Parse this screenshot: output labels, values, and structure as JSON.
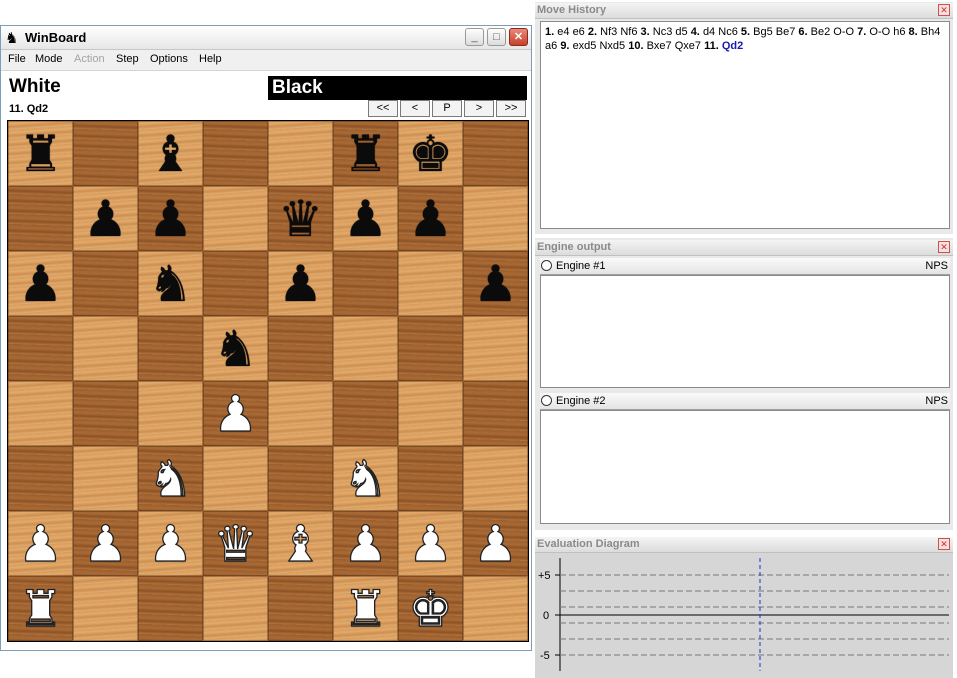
{
  "window": {
    "title": "WinBoard",
    "logo_icon": "♞",
    "minimize_glyph": "_",
    "maximize_glyph": "□",
    "close_glyph": "✕"
  },
  "menu": [
    "File",
    "Mode",
    "Action",
    "Step",
    "Options",
    "Help"
  ],
  "clocks": {
    "white": "White",
    "black": "Black"
  },
  "last_move": "11. Qd2",
  "nav": [
    "<<",
    "<",
    "P",
    ">",
    ">>"
  ],
  "board": [
    "r.b..rk.",
    ".pp.qpp.",
    "p.n.p..p",
    "...n....",
    "...P....",
    "..N..N..",
    "PPPQBPPP",
    "R....RK."
  ],
  "colors": {
    "light_square": "#dca46a",
    "dark_square": "#a2652f",
    "clock_active_bg": "#000000",
    "current_move": "#1a1ab0"
  },
  "move_history": {
    "title": "Move History",
    "moves": [
      {
        "n": "1.",
        "w": "e4",
        "b": "e6"
      },
      {
        "n": "2.",
        "w": "Nf3",
        "b": "Nf6"
      },
      {
        "n": "3.",
        "w": "Nc3",
        "b": "d5"
      },
      {
        "n": "4.",
        "w": "d4",
        "b": "Nc6"
      },
      {
        "n": "5.",
        "w": "Bg5",
        "b": "Be7"
      },
      {
        "n": "6.",
        "w": "Be2",
        "b": "O-O"
      },
      {
        "n": "7.",
        "w": "O-O",
        "b": "h6"
      },
      {
        "n": "8.",
        "w": "Bh4",
        "b": "a6"
      },
      {
        "n": "9.",
        "w": "exd5",
        "b": "Nxd5"
      },
      {
        "n": "10.",
        "w": "Bxe7",
        "b": "Qxe7"
      },
      {
        "n": "11.",
        "w": "Qd2",
        "b": ""
      }
    ]
  },
  "engine_output": {
    "title": "Engine output",
    "engines": [
      {
        "name": "Engine #1",
        "nps": "NPS"
      },
      {
        "name": "Engine #2",
        "nps": "NPS"
      }
    ]
  },
  "evaluation": {
    "title": "Evaluation Diagram",
    "labels": [
      "+5",
      "0",
      "-5"
    ]
  }
}
